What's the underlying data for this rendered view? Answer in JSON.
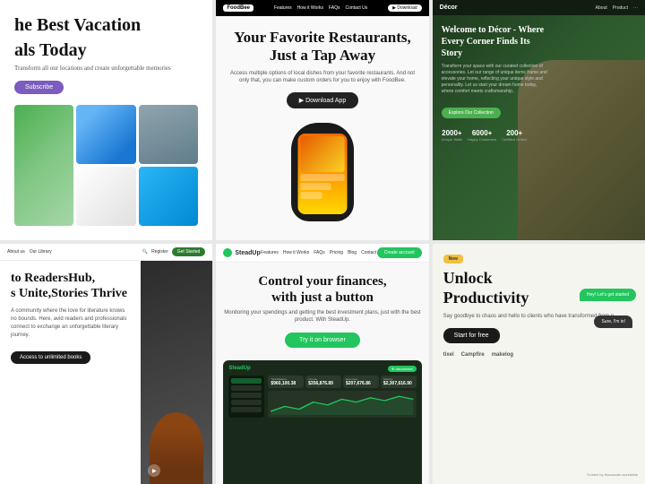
{
  "card1": {
    "headline": "he Best Vacation",
    "headline2": "als Today",
    "subtext": "Transform all our locations and create unforgettable memories",
    "subscribe_label": "Subscribe",
    "images": [
      {
        "id": "palm",
        "class": "img-palm tall"
      },
      {
        "id": "dubai",
        "class": "img-dubai"
      },
      {
        "id": "eiffel",
        "class": "img-eiffel"
      },
      {
        "id": "villa",
        "class": "img-villa"
      },
      {
        "id": "pool",
        "class": "img-pool"
      }
    ]
  },
  "card2": {
    "nav_logo": "FoodBee",
    "nav_links": [
      "Features",
      "How it Works",
      "FAQs",
      "Contact Us"
    ],
    "nav_btn": "Download App",
    "headline": "Your Favorite Restaurants,",
    "headline2": "Just a Tap Away",
    "subtext": "Access multiple options of local dishes from your favorite restaurants. And not only that, you can make custom orders for you to enjoy with FoodBee.",
    "download_label": "▶ Download App"
  },
  "card3": {
    "nav_logo": "Décor",
    "nav_links": [
      "About",
      "Product",
      ""
    ],
    "headline": "Welcome to Décor - Where Every Corner Finds Its Story",
    "subtext": "Transform your space with our curated collection of accessories. Let our range of unique items frame and elevate your home, reflecting your unique style and personality. Let us start your dream home today, where comfort meets craftsmanship.",
    "cta_label": "Explore Our Collection",
    "stats": [
      {
        "num": "2000+",
        "label": "Unique Walls"
      },
      {
        "num": "6000+",
        "label": "Happy Customers"
      },
      {
        "num": "200+",
        "label": "Certified Orders"
      }
    ]
  },
  "card4": {
    "nav_links": [
      "About us",
      "Our Library"
    ],
    "nav_right_links": [
      "🔍",
      "Register"
    ],
    "nav_btn": "Get Started",
    "headline": "to ReadersHub,",
    "headline2": "s Unite,Stories Thrive",
    "subtext": "A community where the love for literature knows no bounds. Here, avid readers and professionals connect to exchange an unforgettable literary journey.",
    "access_btn": "Access to unlimited books",
    "alt_text": "Reader with book"
  },
  "card5": {
    "nav_logo": "SteadUp",
    "nav_links": [
      "Features",
      "How it Works",
      "FAQs",
      "Pricing",
      "Blog",
      "Contact"
    ],
    "nav_btn": "Create account",
    "headline": "Control your finances,",
    "headline2": "with just a button",
    "subtext": "Monitoring your spendings and getting the best investment plans, just with the best product. With SteadUp.",
    "cta_label": "Try it on browser",
    "dash_logo": "SteadUp",
    "dash_btn": "⊕ disconnect",
    "stats": [
      {
        "label": "Total Balance",
        "val": "$960,100.38"
      },
      {
        "label": "Income",
        "val": "$356,876.89"
      },
      {
        "label": "Expenses",
        "val": "$207,676.86"
      },
      {
        "label": "Savings",
        "val": "$2,307,616.90"
      }
    ],
    "chart_bars": [
      20,
      35,
      25,
      40,
      30,
      45,
      50,
      38,
      42,
      55,
      48,
      60
    ]
  },
  "card6": {
    "badge": "New",
    "headline": "Unlock",
    "headline2": "Productivity",
    "subtext": "Say goodbye to chaos and hello to clients who have transformed from p...",
    "cta_label": "Start for free",
    "chat1": "Hey! Let's get started",
    "chat2": "Sure, I'm in!",
    "brands": [
      "tixel",
      "Campfire",
      "makelog"
    ],
    "bottom_note": "Trusted by thousands worldwide"
  }
}
